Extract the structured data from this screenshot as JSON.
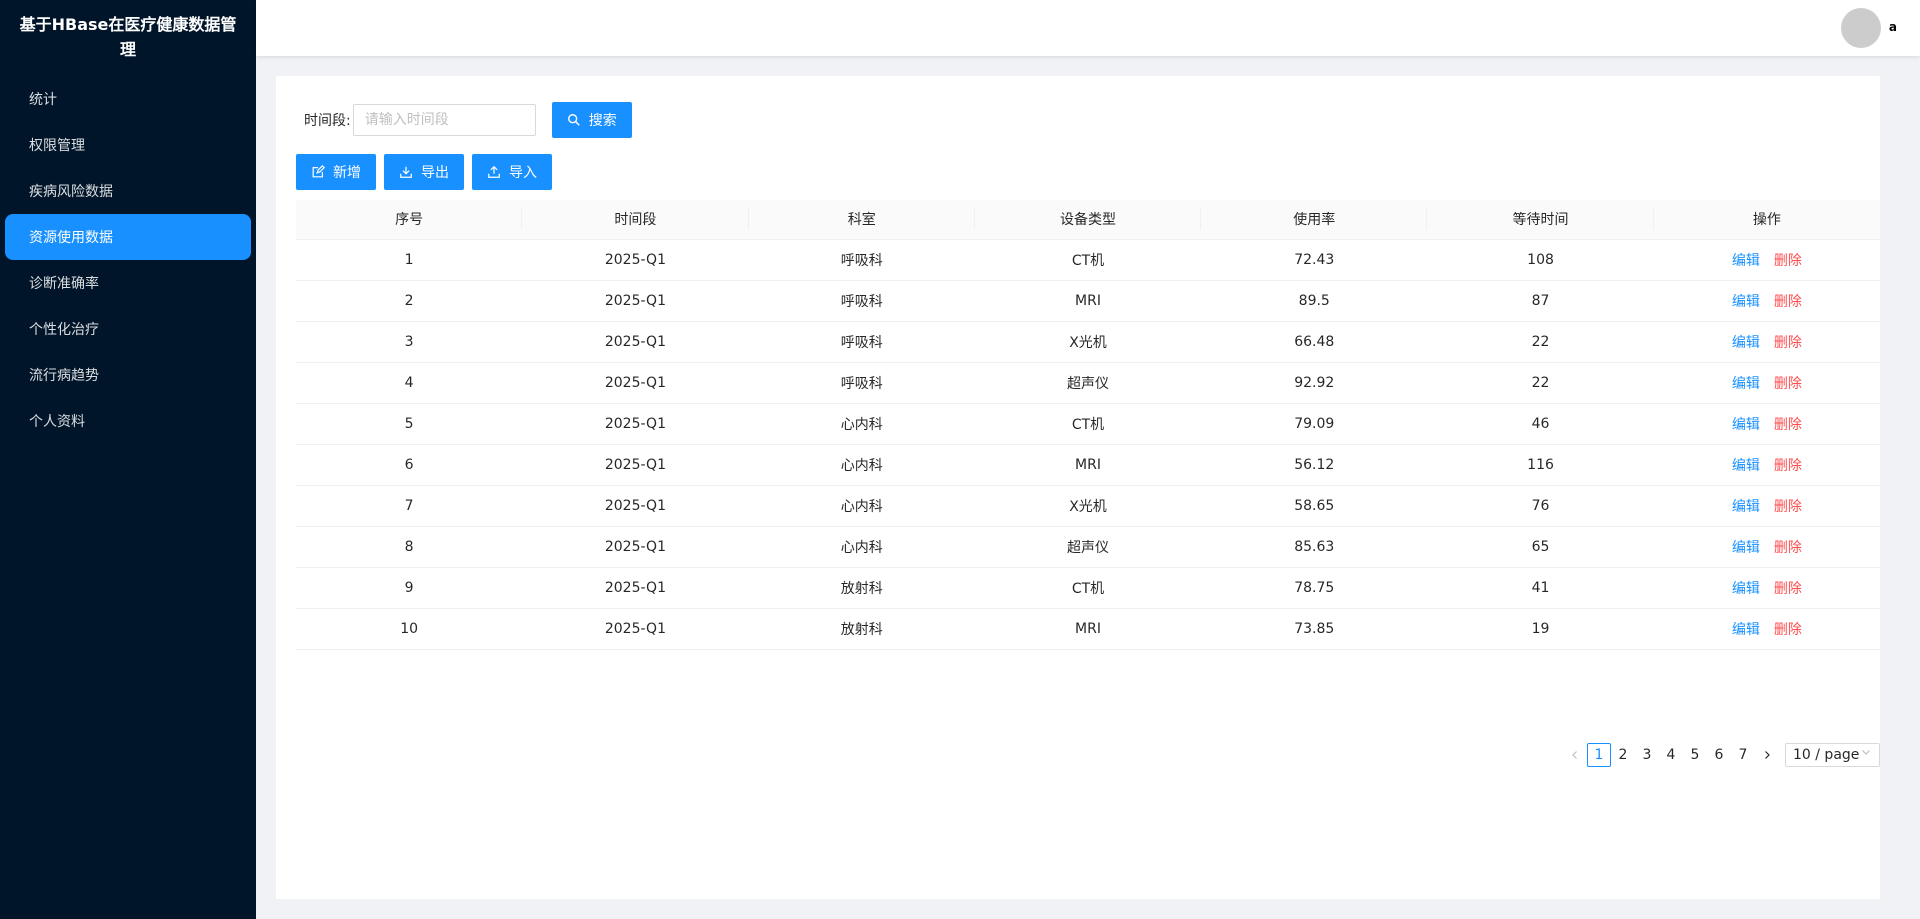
{
  "sidebar": {
    "title": "基于HBase在医疗健康数据管理",
    "items": [
      {
        "label": "统计"
      },
      {
        "label": "权限管理"
      },
      {
        "label": "疾病风险数据"
      },
      {
        "label": "资源使用数据"
      },
      {
        "label": "诊断准确率"
      },
      {
        "label": "个性化治疗"
      },
      {
        "label": "流行病趋势"
      },
      {
        "label": "个人资料"
      }
    ],
    "active_index": 3
  },
  "header": {
    "user_name": "a"
  },
  "search": {
    "label": "时间段:",
    "placeholder": "请输入时间段",
    "button_label": "搜索"
  },
  "actions": {
    "add_label": "新增",
    "export_label": "导出",
    "import_label": "导入"
  },
  "table": {
    "columns": [
      "序号",
      "时间段",
      "科室",
      "设备类型",
      "使用率",
      "等待时间",
      "操作"
    ],
    "rows": [
      [
        "1",
        "2025-Q1",
        "呼吸科",
        "CT机",
        "72.43",
        "108"
      ],
      [
        "2",
        "2025-Q1",
        "呼吸科",
        "MRI",
        "89.5",
        "87"
      ],
      [
        "3",
        "2025-Q1",
        "呼吸科",
        "X光机",
        "66.48",
        "22"
      ],
      [
        "4",
        "2025-Q1",
        "呼吸科",
        "超声仪",
        "92.92",
        "22"
      ],
      [
        "5",
        "2025-Q1",
        "心内科",
        "CT机",
        "79.09",
        "46"
      ],
      [
        "6",
        "2025-Q1",
        "心内科",
        "MRI",
        "56.12",
        "116"
      ],
      [
        "7",
        "2025-Q1",
        "心内科",
        "X光机",
        "58.65",
        "76"
      ],
      [
        "8",
        "2025-Q1",
        "心内科",
        "超声仪",
        "85.63",
        "65"
      ],
      [
        "9",
        "2025-Q1",
        "放射科",
        "CT机",
        "78.75",
        "41"
      ],
      [
        "10",
        "2025-Q1",
        "放射科",
        "MRI",
        "73.85",
        "19"
      ]
    ],
    "edit_label": "编辑",
    "delete_label": "删除"
  },
  "pagination": {
    "pages": [
      "1",
      "2",
      "3",
      "4",
      "5",
      "6",
      "7"
    ],
    "current": "1",
    "page_size": "10 / page"
  },
  "colors": {
    "sidebar_bg": "#001529",
    "primary": "#1890ff",
    "danger": "#ff4d4f"
  }
}
